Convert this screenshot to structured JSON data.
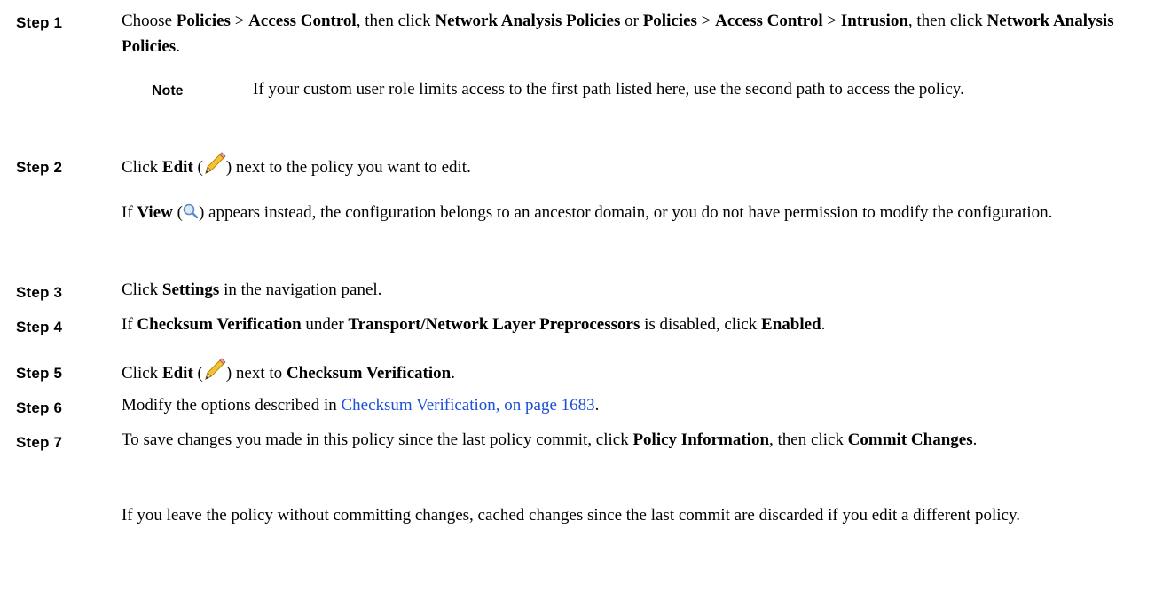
{
  "steps": [
    {
      "label": "Step 1",
      "parts": {
        "a": "Choose ",
        "b1": "Policies",
        "c": " > ",
        "b2": "Access Control",
        "d": ", then click ",
        "b3": "Network Analysis Policies",
        "e": " or ",
        "b4": "Policies",
        "f": "  > ",
        "b5": "Access Control",
        "g": " > ",
        "b6": "Intrusion",
        "h": ", then click ",
        "b7": "Network Analysis Policies",
        "i": "."
      },
      "note": {
        "label": "Note",
        "text": "If your custom user role limits access to the first path listed here, use the second path to access the policy."
      }
    },
    {
      "label": "Step 2",
      "parts": {
        "a": "Click ",
        "b1": "Edit",
        "c": " (",
        "icon": "pencil-icon",
        "d": ") next to the policy you want to edit."
      },
      "extra": {
        "a": "If ",
        "b1": "View",
        "c": " (",
        "icon": "magnifier-icon",
        "d": ") appears instead, the configuration belongs to an ancestor domain, or you do not have permission to modify the configuration."
      }
    },
    {
      "label": "Step 3",
      "parts": {
        "a": "Click ",
        "b1": "Settings",
        "c": " in the navigation panel."
      }
    },
    {
      "label": "Step 4",
      "parts": {
        "a": "If ",
        "b1": "Checksum Verification",
        "c": " under ",
        "b2": "Transport/Network Layer Preprocessors",
        "d": " is disabled, click ",
        "b3": "Enabled",
        "e": "."
      }
    },
    {
      "label": "Step 5",
      "parts": {
        "a": "Click ",
        "b1": "Edit",
        "c": " (",
        "icon": "pencil-icon",
        "d": ") next to ",
        "b2": "Checksum Verification",
        "e": "."
      }
    },
    {
      "label": "Step 6",
      "parts": {
        "a": "Modify the options described in ",
        "link": "Checksum Verification, on page 1683",
        "b": "."
      }
    },
    {
      "label": "Step 7",
      "parts": {
        "a": "To save changes you made in this policy since the last policy commit, click ",
        "b1": "Policy Information",
        "c": ", then click ",
        "b2": "Commit Changes",
        "d": "."
      },
      "extra": {
        "text": "If you leave the policy without committing changes, cached changes since the last commit are discarded if you edit a different policy."
      }
    }
  ],
  "colors": {
    "link": "#1a4fd6",
    "text": "#000000"
  }
}
